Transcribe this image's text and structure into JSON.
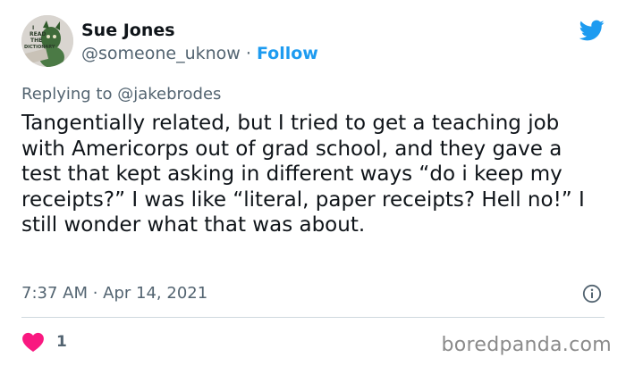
{
  "author": {
    "name": "Sue Jones",
    "handle": "@someone_uknow",
    "separator": " · ",
    "follow_label": "Follow",
    "avatar_text": [
      "I",
      "READ",
      "THE",
      "DICTIONARY"
    ]
  },
  "reply": {
    "prefix": "Replying to ",
    "to_handle": "@jakebrodes"
  },
  "tweet": {
    "text": "Tangentially related, but I tried to get a teaching job with Americorps out of grad school, and they gave a test that kept asking in different ways “do i keep my receipts?” I was like “literal, paper receipts? Hell no!” I still wonder what that was about.",
    "timestamp": "7:37 AM · Apr 14, 2021",
    "like_count": "1"
  },
  "icons": {
    "brand": "twitter-bird-icon",
    "info": "info-icon",
    "like": "heart-icon"
  },
  "colors": {
    "twitter_blue": "#1d9bf0",
    "like_red": "#f91880",
    "text_primary": "#0f1419",
    "text_secondary": "#536471"
  },
  "watermark": "boredpanda.com"
}
